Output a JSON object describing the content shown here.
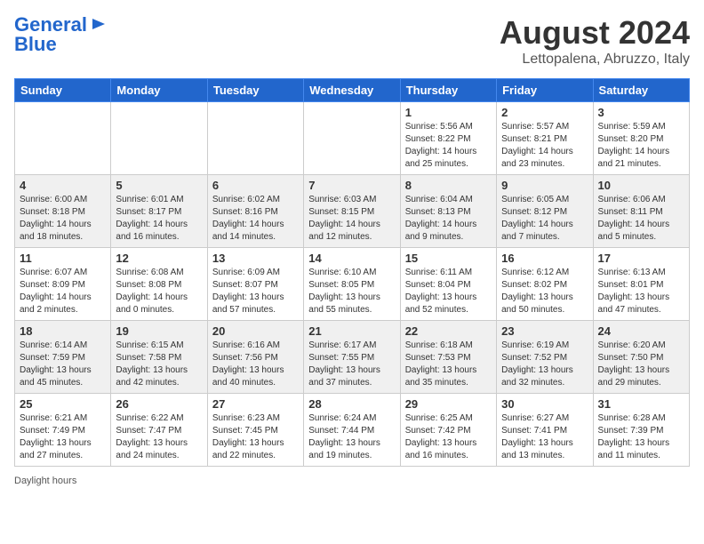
{
  "logo": {
    "line1": "General",
    "line2": "Blue"
  },
  "title": "August 2024",
  "subtitle": "Lettopalena, Abruzzo, Italy",
  "days_of_week": [
    "Sunday",
    "Monday",
    "Tuesday",
    "Wednesday",
    "Thursday",
    "Friday",
    "Saturday"
  ],
  "footer": "Daylight hours",
  "weeks": [
    [
      {
        "num": "",
        "info": ""
      },
      {
        "num": "",
        "info": ""
      },
      {
        "num": "",
        "info": ""
      },
      {
        "num": "",
        "info": ""
      },
      {
        "num": "1",
        "info": "Sunrise: 5:56 AM\nSunset: 8:22 PM\nDaylight: 14 hours and 25 minutes."
      },
      {
        "num": "2",
        "info": "Sunrise: 5:57 AM\nSunset: 8:21 PM\nDaylight: 14 hours and 23 minutes."
      },
      {
        "num": "3",
        "info": "Sunrise: 5:59 AM\nSunset: 8:20 PM\nDaylight: 14 hours and 21 minutes."
      }
    ],
    [
      {
        "num": "4",
        "info": "Sunrise: 6:00 AM\nSunset: 8:18 PM\nDaylight: 14 hours and 18 minutes."
      },
      {
        "num": "5",
        "info": "Sunrise: 6:01 AM\nSunset: 8:17 PM\nDaylight: 14 hours and 16 minutes."
      },
      {
        "num": "6",
        "info": "Sunrise: 6:02 AM\nSunset: 8:16 PM\nDaylight: 14 hours and 14 minutes."
      },
      {
        "num": "7",
        "info": "Sunrise: 6:03 AM\nSunset: 8:15 PM\nDaylight: 14 hours and 12 minutes."
      },
      {
        "num": "8",
        "info": "Sunrise: 6:04 AM\nSunset: 8:13 PM\nDaylight: 14 hours and 9 minutes."
      },
      {
        "num": "9",
        "info": "Sunrise: 6:05 AM\nSunset: 8:12 PM\nDaylight: 14 hours and 7 minutes."
      },
      {
        "num": "10",
        "info": "Sunrise: 6:06 AM\nSunset: 8:11 PM\nDaylight: 14 hours and 5 minutes."
      }
    ],
    [
      {
        "num": "11",
        "info": "Sunrise: 6:07 AM\nSunset: 8:09 PM\nDaylight: 14 hours and 2 minutes."
      },
      {
        "num": "12",
        "info": "Sunrise: 6:08 AM\nSunset: 8:08 PM\nDaylight: 14 hours and 0 minutes."
      },
      {
        "num": "13",
        "info": "Sunrise: 6:09 AM\nSunset: 8:07 PM\nDaylight: 13 hours and 57 minutes."
      },
      {
        "num": "14",
        "info": "Sunrise: 6:10 AM\nSunset: 8:05 PM\nDaylight: 13 hours and 55 minutes."
      },
      {
        "num": "15",
        "info": "Sunrise: 6:11 AM\nSunset: 8:04 PM\nDaylight: 13 hours and 52 minutes."
      },
      {
        "num": "16",
        "info": "Sunrise: 6:12 AM\nSunset: 8:02 PM\nDaylight: 13 hours and 50 minutes."
      },
      {
        "num": "17",
        "info": "Sunrise: 6:13 AM\nSunset: 8:01 PM\nDaylight: 13 hours and 47 minutes."
      }
    ],
    [
      {
        "num": "18",
        "info": "Sunrise: 6:14 AM\nSunset: 7:59 PM\nDaylight: 13 hours and 45 minutes."
      },
      {
        "num": "19",
        "info": "Sunrise: 6:15 AM\nSunset: 7:58 PM\nDaylight: 13 hours and 42 minutes."
      },
      {
        "num": "20",
        "info": "Sunrise: 6:16 AM\nSunset: 7:56 PM\nDaylight: 13 hours and 40 minutes."
      },
      {
        "num": "21",
        "info": "Sunrise: 6:17 AM\nSunset: 7:55 PM\nDaylight: 13 hours and 37 minutes."
      },
      {
        "num": "22",
        "info": "Sunrise: 6:18 AM\nSunset: 7:53 PM\nDaylight: 13 hours and 35 minutes."
      },
      {
        "num": "23",
        "info": "Sunrise: 6:19 AM\nSunset: 7:52 PM\nDaylight: 13 hours and 32 minutes."
      },
      {
        "num": "24",
        "info": "Sunrise: 6:20 AM\nSunset: 7:50 PM\nDaylight: 13 hours and 29 minutes."
      }
    ],
    [
      {
        "num": "25",
        "info": "Sunrise: 6:21 AM\nSunset: 7:49 PM\nDaylight: 13 hours and 27 minutes."
      },
      {
        "num": "26",
        "info": "Sunrise: 6:22 AM\nSunset: 7:47 PM\nDaylight: 13 hours and 24 minutes."
      },
      {
        "num": "27",
        "info": "Sunrise: 6:23 AM\nSunset: 7:45 PM\nDaylight: 13 hours and 22 minutes."
      },
      {
        "num": "28",
        "info": "Sunrise: 6:24 AM\nSunset: 7:44 PM\nDaylight: 13 hours and 19 minutes."
      },
      {
        "num": "29",
        "info": "Sunrise: 6:25 AM\nSunset: 7:42 PM\nDaylight: 13 hours and 16 minutes."
      },
      {
        "num": "30",
        "info": "Sunrise: 6:27 AM\nSunset: 7:41 PM\nDaylight: 13 hours and 13 minutes."
      },
      {
        "num": "31",
        "info": "Sunrise: 6:28 AM\nSunset: 7:39 PM\nDaylight: 13 hours and 11 minutes."
      }
    ]
  ]
}
